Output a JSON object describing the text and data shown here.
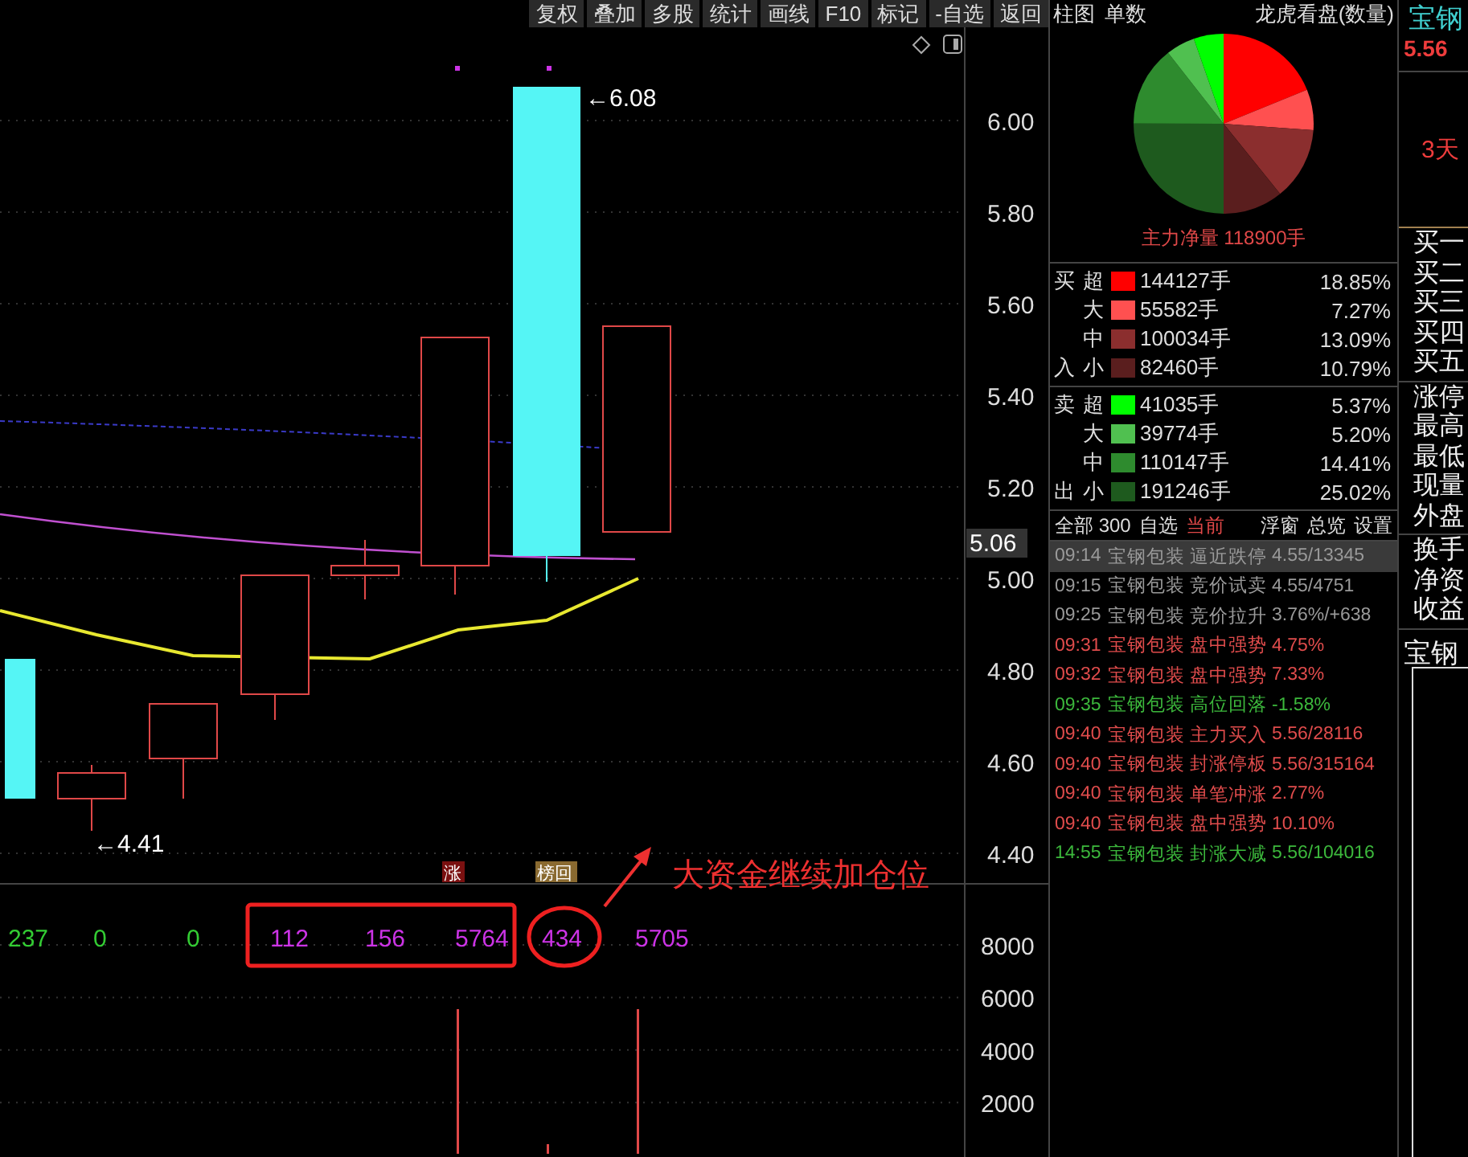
{
  "toolbar": [
    "复权",
    "叠加",
    "多股",
    "统计",
    "画线",
    "F10",
    "标记",
    "-自选",
    "返回"
  ],
  "price_chart": {
    "high_label": "←6.08",
    "low_label": "←4.41",
    "price_ticks": [
      "6.00",
      "5.80",
      "5.60",
      "5.40",
      "5.20",
      "5.00",
      "4.80",
      "4.60",
      "4.40"
    ],
    "current_price": "5.06",
    "markers": [
      "涨",
      "榜回"
    ]
  },
  "volume_panel": {
    "values": [
      {
        "text": "237",
        "color": "#33cc33"
      },
      {
        "text": "0",
        "color": "#33cc33"
      },
      {
        "text": "0",
        "color": "#33cc33"
      },
      {
        "text": "112",
        "color": "#cc33e6"
      },
      {
        "text": "156",
        "color": "#cc33e6"
      },
      {
        "text": "5764",
        "color": "#cc33e6"
      },
      {
        "text": "434",
        "color": "#cc33e6"
      },
      {
        "text": "5705",
        "color": "#cc33e6"
      }
    ],
    "ticks": [
      "8000",
      "6000",
      "4000",
      "2000"
    ]
  },
  "annotation": "大资金继续加仓位",
  "flow_panel": {
    "view_buttons": [
      "柱图",
      "单数"
    ],
    "title": "龙虎看盘(数量)",
    "net_volume": "主力净量 118900手",
    "groups": [
      {
        "label_top": "买",
        "label_bottom": "入",
        "rows": [
          {
            "size": "超",
            "color": "#ff0000",
            "volume": "144127手",
            "percent": "18.85%"
          },
          {
            "size": "大",
            "color": "#ff5050",
            "volume": "55582手",
            "percent": "7.27%"
          },
          {
            "size": "中",
            "color": "#8b2e2e",
            "volume": "100034手",
            "percent": "13.09%"
          },
          {
            "size": "小",
            "color": "#5a1e1e",
            "volume": "82460手",
            "percent": "10.79%"
          }
        ]
      },
      {
        "label_top": "卖",
        "label_bottom": "出",
        "rows": [
          {
            "size": "超",
            "color": "#00ff00",
            "volume": "41035手",
            "percent": "5.37%"
          },
          {
            "size": "大",
            "color": "#50c050",
            "volume": "39774手",
            "percent": "5.20%"
          },
          {
            "size": "中",
            "color": "#2e8b2e",
            "volume": "110147手",
            "percent": "14.41%"
          },
          {
            "size": "小",
            "color": "#1e5a1e",
            "volume": "191246手",
            "percent": "25.02%"
          }
        ]
      }
    ]
  },
  "alert_panel": {
    "tabs": [
      {
        "label": "全部 300",
        "selected": false
      },
      {
        "label": "自选",
        "selected": false
      },
      {
        "label": "当前",
        "selected": true
      }
    ],
    "tools": [
      "浮窗",
      "总览",
      "设置"
    ],
    "alerts": [
      {
        "time": "09:14",
        "stock": "宝钢包装",
        "event": "逼近跌停",
        "value": "4.55/13345",
        "color": "#9a9a9a",
        "selected": true
      },
      {
        "time": "09:15",
        "stock": "宝钢包装",
        "event": "竞价试卖",
        "value": "4.55/4751",
        "color": "#9a9a9a",
        "selected": false
      },
      {
        "time": "09:25",
        "stock": "宝钢包装",
        "event": "竞价拉升",
        "value": "3.76%/+638",
        "color": "#9a9a9a",
        "selected": false
      },
      {
        "time": "09:31",
        "stock": "宝钢包装",
        "event": "盘中强势",
        "value": "4.75%",
        "color": "#e04c4c",
        "selected": false
      },
      {
        "time": "09:32",
        "stock": "宝钢包装",
        "event": "盘中强势",
        "value": "7.33%",
        "color": "#e04c4c",
        "selected": false
      },
      {
        "time": "09:35",
        "stock": "宝钢包装",
        "event": "高位回落",
        "value": "-1.58%",
        "color": "#3cb83c",
        "selected": false
      },
      {
        "time": "09:40",
        "stock": "宝钢包装",
        "event": "主力买入",
        "value": "5.56/28116",
        "color": "#e04c4c",
        "selected": false
      },
      {
        "time": "09:40",
        "stock": "宝钢包装",
        "event": "封涨停板",
        "value": "5.56/315164",
        "color": "#e04c4c",
        "selected": false
      },
      {
        "time": "09:40",
        "stock": "宝钢包装",
        "event": "单笔冲涨",
        "value": "2.77%",
        "color": "#e04c4c",
        "selected": false
      },
      {
        "time": "09:40",
        "stock": "宝钢包装",
        "event": "盘中强势",
        "value": "10.10%",
        "color": "#e04c4c",
        "selected": false
      },
      {
        "time": "14:55",
        "stock": "宝钢包装",
        "event": "封涨大减",
        "value": "5.56/104016",
        "color": "#3cb83c",
        "selected": false
      }
    ]
  },
  "sidebar": {
    "name": "宝钢",
    "price": "5.56",
    "note": "3天",
    "label_groups": [
      [
        "买一",
        "买二",
        "买三",
        "买四",
        "买五"
      ],
      [
        "涨停",
        "最高",
        "最低",
        "现量",
        "外盘"
      ],
      [
        "换手",
        "净资",
        "收益"
      ]
    ],
    "second_name": "宝钢"
  }
}
